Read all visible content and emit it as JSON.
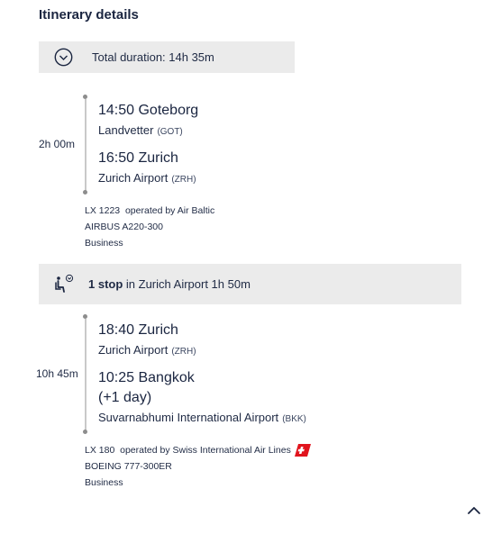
{
  "title": "Itinerary details",
  "total_duration": "Total duration: 14h 35m",
  "segments": [
    {
      "duration": "2h 00m",
      "departure": {
        "time_place": "14:50 Goteborg",
        "airport": "Landvetter",
        "code": "(GOT)"
      },
      "arrival": {
        "time_place": "16:50 Zurich",
        "airport": "Zurich Airport",
        "code": "(ZRH)"
      },
      "flight": "LX 1223",
      "operated_by": "operated by Air Baltic",
      "aircraft": "AIRBUS A220-300",
      "cabin": "Business"
    },
    {
      "duration": "10h 45m",
      "departure": {
        "time_place": "18:40 Zurich",
        "airport": "Zurich Airport",
        "code": "(ZRH)"
      },
      "arrival": {
        "time_place": "10:25 Bangkok",
        "day_offset": "(+1 day)",
        "airport": "Suvarnabhumi International Airport",
        "code": "(BKK)"
      },
      "flight": "LX 180",
      "operated_by": "operated by Swiss International Air Lines",
      "aircraft": "BOEING 777-300ER",
      "cabin": "Business"
    }
  ],
  "stop": {
    "count_label": "1 stop",
    "detail": " in Zurich Airport 1h 50m"
  },
  "icons": {
    "clock": "clock-icon",
    "stop": "seated-passenger-clock-icon",
    "airline_logo": "swiss-logo",
    "collapse": "chevron-up-icon"
  },
  "colors": {
    "text": "#1f2a44",
    "panel": "#ebebeb",
    "swiss_red": "#e1141d"
  }
}
